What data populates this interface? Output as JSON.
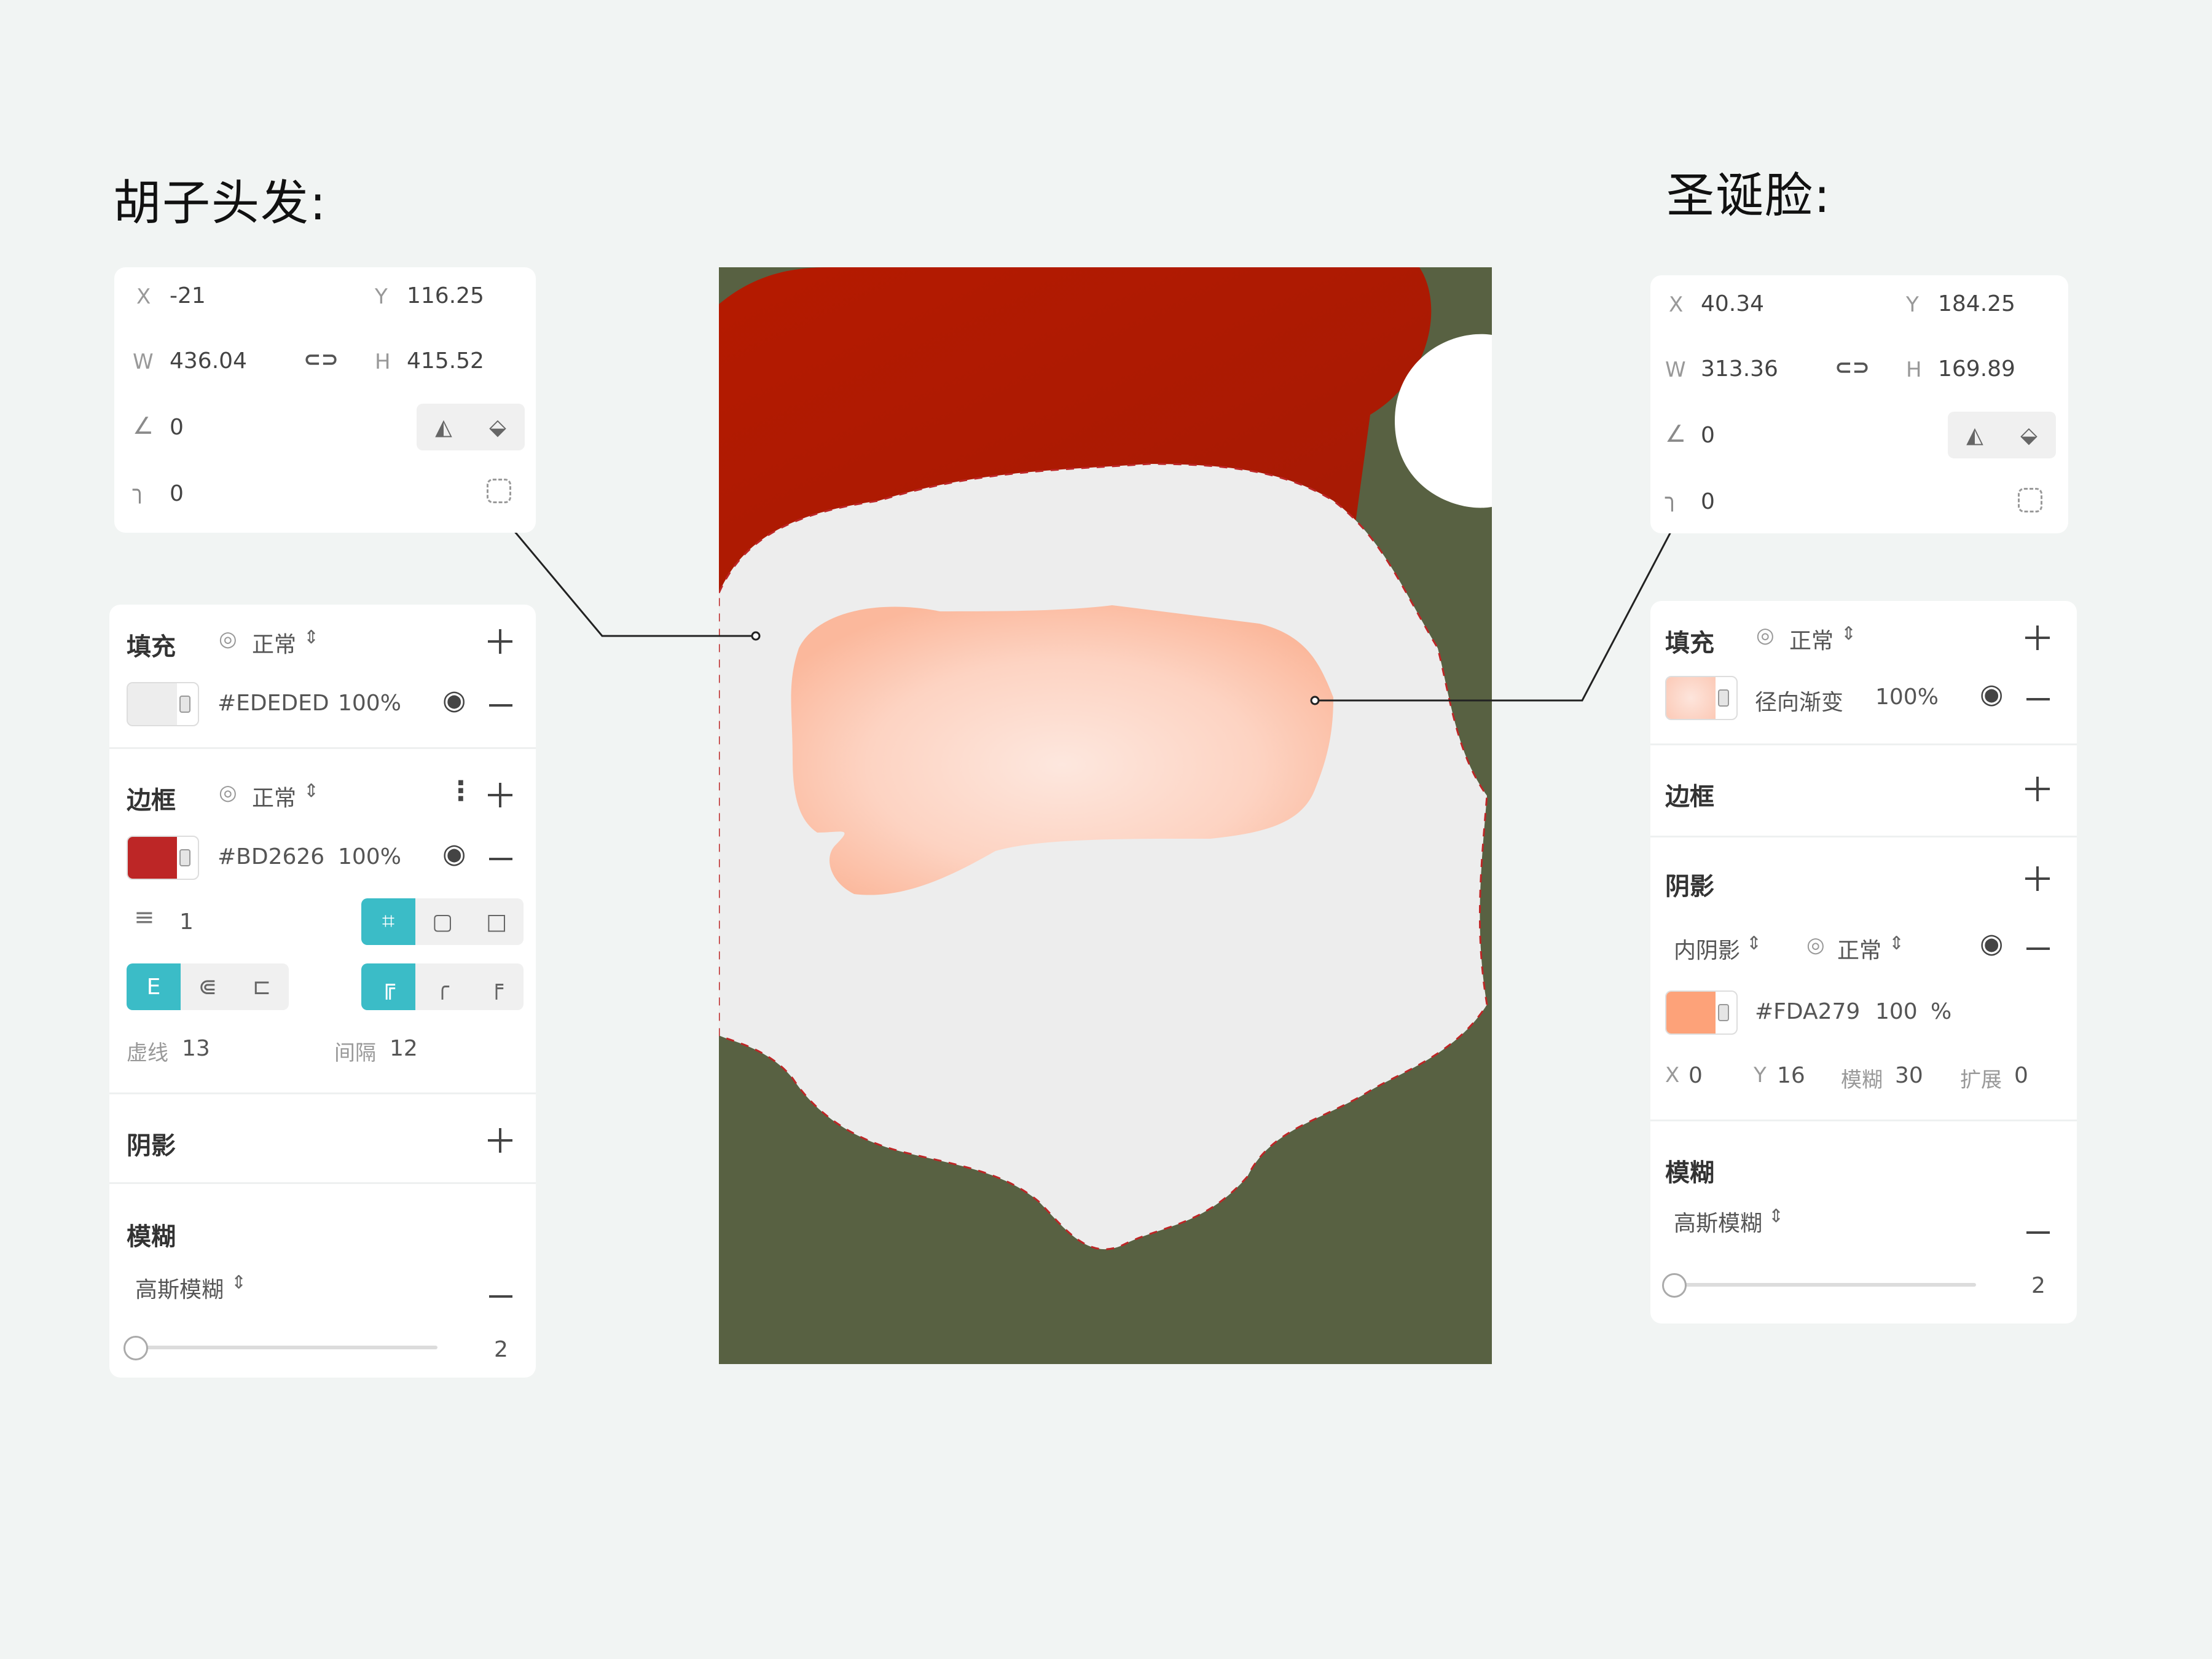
{
  "left": {
    "title": "胡子头发:",
    "transform": {
      "x_label": "X",
      "x_value": "-21",
      "y_label": "Y",
      "y_value": "116.25",
      "w_label": "W",
      "w_value": "436.04",
      "h_label": "H",
      "h_value": "415.52",
      "angle_value": "0",
      "radius_value": "0"
    },
    "fill": {
      "label": "填充",
      "blend": "正常",
      "color_hex": "#EDEDED",
      "opacity": "100%",
      "swatch": "#EDEDED"
    },
    "border": {
      "label": "边框",
      "blend": "正常",
      "color_hex": "#BD2626",
      "opacity": "100%",
      "swatch": "#BD2626",
      "width": "1",
      "dash_label": "虚线",
      "dash_value": "13",
      "gap_label": "间隔",
      "gap_value": "12"
    },
    "shadow": {
      "label": "阴影"
    },
    "blur": {
      "label": "模糊",
      "type": "高斯模糊",
      "value": "2",
      "level": 0.0
    }
  },
  "right": {
    "title": "圣诞脸:",
    "transform": {
      "x_label": "X",
      "x_value": "40.34",
      "y_label": "Y",
      "y_value": "184.25",
      "w_label": "W",
      "w_value": "313.36",
      "h_label": "H",
      "h_value": "169.89",
      "angle_value": "0",
      "radius_value": "0"
    },
    "fill": {
      "label": "填充",
      "blend": "正常",
      "type": "径向渐变",
      "opacity": "100%",
      "swatch": "#FCD3C6"
    },
    "border": {
      "label": "边框"
    },
    "shadow": {
      "label": "阴影",
      "type": "内阴影",
      "blend": "正常",
      "color_hex": "#FDA279",
      "opacity": "100",
      "percent": "%",
      "swatch": "#FDA279",
      "x_label": "X",
      "x_value": "0",
      "y_label": "Y",
      "y_value": "16",
      "blur_label": "模糊",
      "blur_value": "30",
      "spread_label": "扩展",
      "spread_value": "0"
    },
    "blur": {
      "label": "模糊",
      "type": "高斯模糊",
      "value": "2",
      "level": 0.0
    }
  },
  "canvas": {
    "background": "#586142",
    "hat_color": "#B51A00",
    "beard_color": "#EDEDED",
    "beard_border": "#BD2626",
    "face_color": "#FDCDB9"
  },
  "icons": {
    "link": "link-icon",
    "angle": "angle-icon",
    "radius": "corner-radius-icon",
    "flip_h": "flip-horizontal-icon",
    "flip_v": "flip-vertical-icon",
    "eye": "eye-icon",
    "blend": "blend-mode-icon",
    "more": "more-vertical-icon"
  }
}
